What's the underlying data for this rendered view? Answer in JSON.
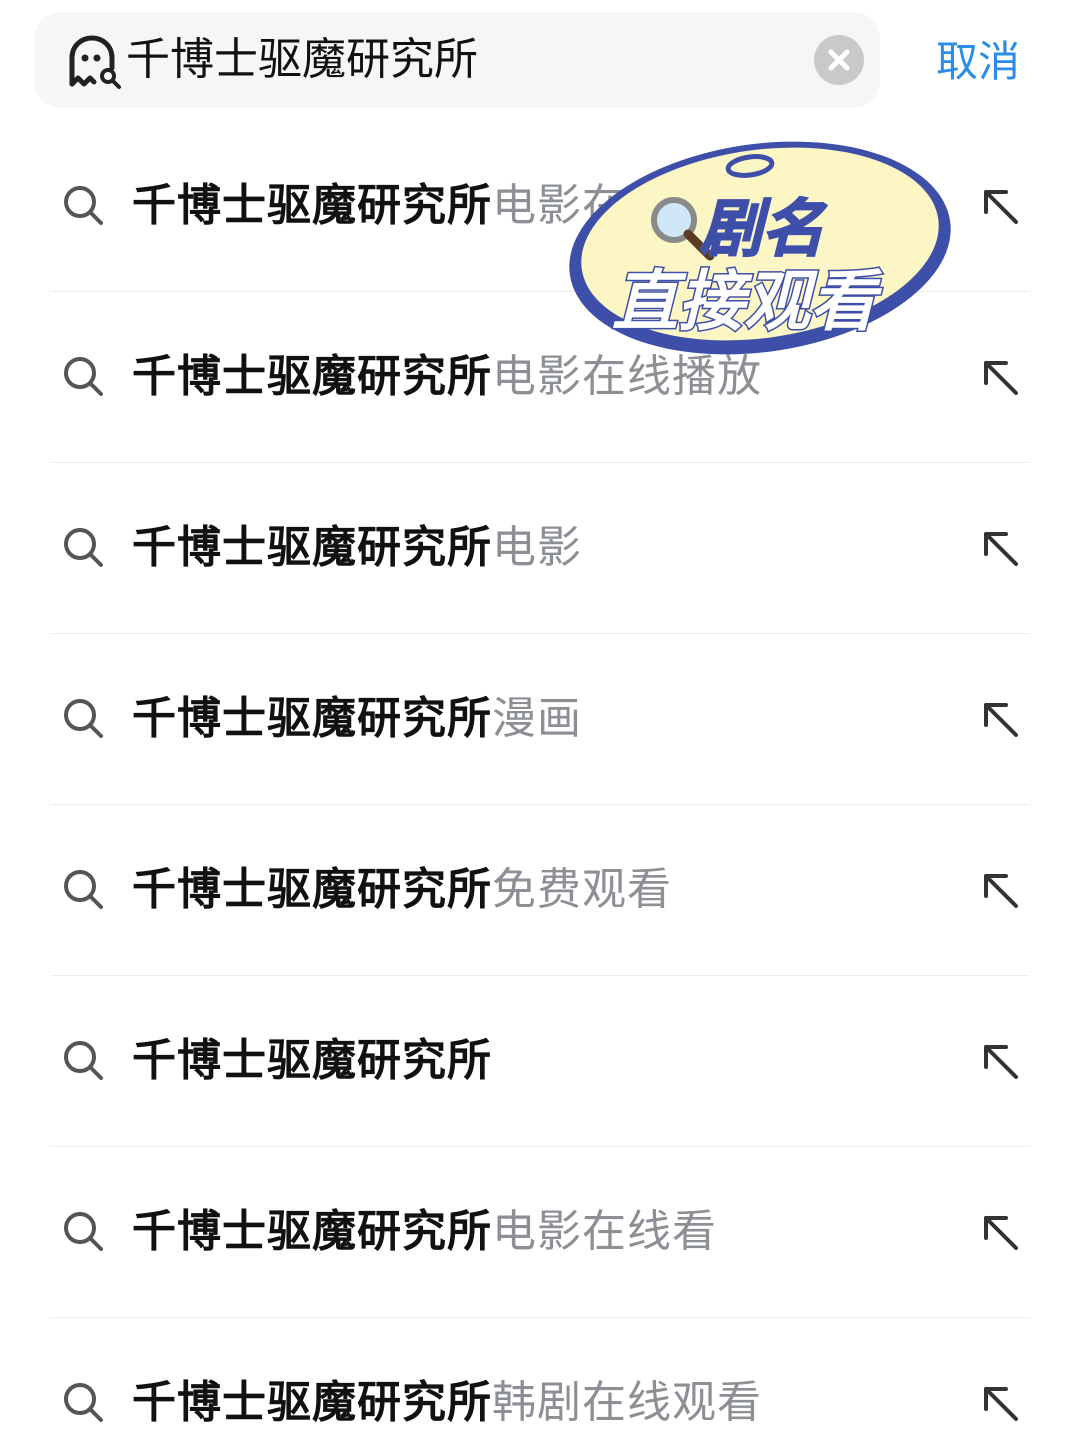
{
  "search": {
    "query": "千博士驱魔研究所",
    "cancel_label": "取消"
  },
  "suggestions": [
    {
      "bold": "千博士驱魔研究所",
      "rest": "电影在线播放"
    },
    {
      "bold": "千博士驱魔研究所",
      "rest": "电影在线播放"
    },
    {
      "bold": "千博士驱魔研究所",
      "rest": "电影"
    },
    {
      "bold": "千博士驱魔研究所",
      "rest": "漫画"
    },
    {
      "bold": "千博士驱魔研究所",
      "rest": "免费观看"
    },
    {
      "bold": "千博士驱魔研究所",
      "rest": ""
    },
    {
      "bold": "千博士驱魔研究所",
      "rest": "电影在线看"
    },
    {
      "bold": "千博士驱魔研究所",
      "rest": "韩剧在线观看"
    }
  ],
  "sticker": {
    "line1": "剧名",
    "line2": "直接观看"
  },
  "colors": {
    "accent": "#2b8de8",
    "sticker_fill": "#fbf6c4",
    "sticker_outline": "#3d4fa8"
  }
}
